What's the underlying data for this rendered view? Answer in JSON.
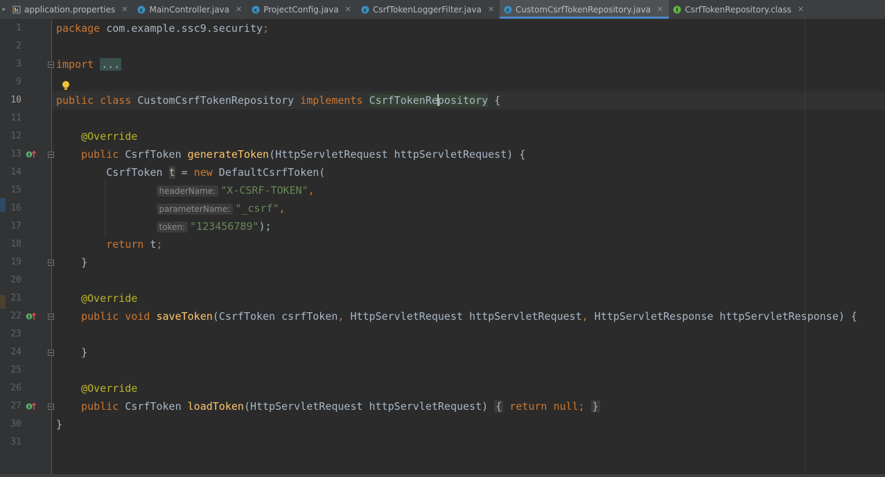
{
  "tabs": [
    {
      "label": "application.properties",
      "icon": "properties-file-icon",
      "active": false
    },
    {
      "label": "MainController.java",
      "icon": "java-class-icon",
      "active": false
    },
    {
      "label": "ProjectConfig.java",
      "icon": "java-class-icon",
      "active": false
    },
    {
      "label": "CsrfTokenLoggerFilter.java",
      "icon": "java-class-icon",
      "active": false
    },
    {
      "label": "CustomCsrfTokenRepository.java",
      "icon": "java-class-icon",
      "active": true
    },
    {
      "label": "CsrfTokenRepository.class",
      "icon": "interface-class-icon",
      "active": false
    }
  ],
  "line_numbers": [
    "1",
    "2",
    "3",
    "9",
    "10",
    "11",
    "12",
    "13",
    "14",
    "15",
    "16",
    "17",
    "18",
    "19",
    "20",
    "21",
    "22",
    "23",
    "24",
    "25",
    "26",
    "27",
    "30",
    "31"
  ],
  "current_line": "10",
  "code": {
    "l1": {
      "kw": "package",
      "text": " com.example.ssc9.security",
      "semi": ";"
    },
    "l3": {
      "kw": "import",
      "dots": "..."
    },
    "l10": {
      "kw1": "public",
      "kw2": "class",
      "name": "CustomCsrfTokenRepository",
      "kw3": "implements",
      "iface_a": "CsrfTokenRe",
      "iface_b": "pository",
      "brace": "{"
    },
    "l12": {
      "ann": "@Override"
    },
    "l13": {
      "kw": "public",
      "type": "CsrfToken",
      "fn": "generateToken",
      "params": "(HttpServletRequest httpServletRequest) {"
    },
    "l14": {
      "type": "CsrfToken ",
      "var": "t",
      "eq": " = ",
      "kw": "new",
      "ctor": " DefaultCsrfToken("
    },
    "l15": {
      "hint": "headerName:",
      "str": "\"X-CSRF-TOKEN\"",
      "tail": ","
    },
    "l16": {
      "hint": "parameterName:",
      "str": "\"_csrf\"",
      "tail": ","
    },
    "l17": {
      "hint": "token:",
      "str": "\"123456789\"",
      "tail": ");"
    },
    "l18": {
      "kw": "return",
      "tail": " t",
      "semi": ";"
    },
    "l19": {
      "text": "}"
    },
    "l21": {
      "ann": "@Override"
    },
    "l22": {
      "kw1": "public",
      "kw2": "void",
      "fn": "saveToken",
      "p1": "(CsrfToken csrfToken",
      "c1": ",",
      "p2": " HttpServletRequest httpServletRequest",
      "c2": ",",
      "p3": " HttpServletResponse httpServletResponse) {"
    },
    "l24": {
      "text": "}"
    },
    "l26": {
      "ann": "@Override"
    },
    "l27": {
      "kw": "public",
      "type": "CsrfToken",
      "fn": "loadToken",
      "params": "(HttpServletRequest httpServletRequest)",
      "ob": "{",
      "kw2": "return",
      "kw3": "null",
      "semi": ";",
      "cb": "}"
    },
    "l30": {
      "text": "}"
    }
  },
  "colors": {
    "background": "#2b2b2b",
    "gutter": "#313335",
    "keyword": "#cc7832",
    "annotation": "#bbb529",
    "method": "#ffc66d",
    "string": "#6a8759",
    "text": "#a9b7c6",
    "active_tab_underline": "#4a88c7"
  }
}
